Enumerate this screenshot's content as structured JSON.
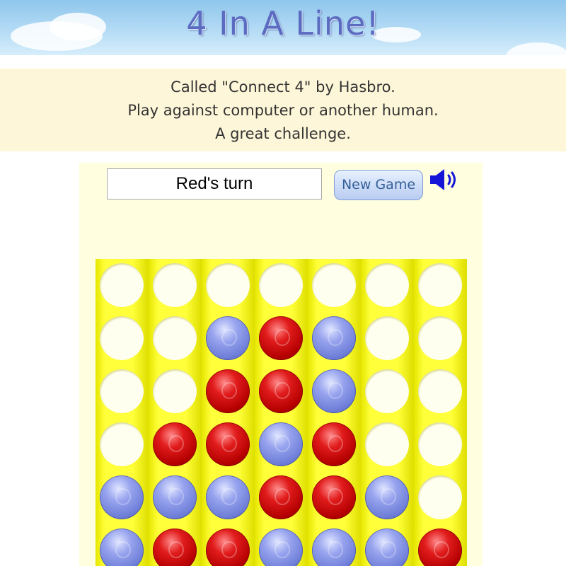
{
  "header": {
    "title": "4 In A Line!"
  },
  "intro": {
    "lines": [
      "Called \"Connect 4\" by Hasbro.",
      "Play against computer or another human.",
      "A great challenge."
    ]
  },
  "game": {
    "status": "Red's turn",
    "new_game_label": "New Game",
    "sound_icon": "speaker-icon"
  },
  "board": {
    "columns": 7,
    "visible_rows": 6,
    "rows": [
      [
        "empty",
        "empty",
        "empty",
        "empty",
        "empty",
        "empty",
        "empty"
      ],
      [
        "empty",
        "empty",
        "blue",
        "red",
        "blue",
        "empty",
        "empty"
      ],
      [
        "empty",
        "empty",
        "red",
        "red",
        "blue",
        "empty",
        "empty"
      ],
      [
        "empty",
        "red",
        "red",
        "blue",
        "red",
        "empty",
        "empty"
      ],
      [
        "blue",
        "blue",
        "blue",
        "red",
        "red",
        "blue",
        "empty"
      ],
      [
        "blue",
        "red",
        "red",
        "blue",
        "blue",
        "blue",
        "red"
      ]
    ]
  },
  "colors": {
    "sky": "#b4dbf5",
    "intro_bg": "#fdf6d8",
    "panel_bg": "#ffffe0",
    "board_yellow": "#f3f300",
    "red_piece": "#d61010",
    "blue_piece": "#7f8ee0"
  }
}
